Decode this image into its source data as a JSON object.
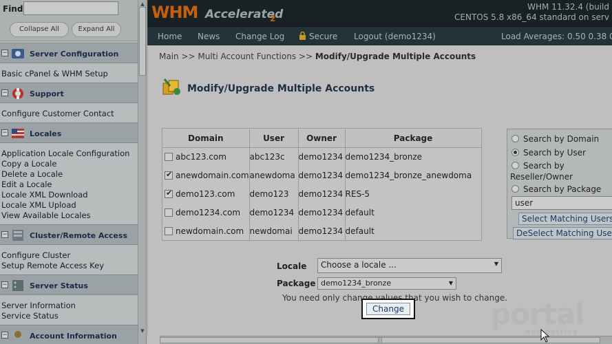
{
  "sidebar": {
    "find_label": "Find",
    "find_value": "",
    "collapse_all": "Collapse All",
    "expand_all": "Expand All",
    "sections": [
      {
        "title": "Server Configuration",
        "icon": "wrench-icon",
        "links": [
          "Basic cPanel & WHM Setup"
        ]
      },
      {
        "title": "Support",
        "icon": "lifebuoy-icon",
        "links": [
          "Configure Customer Contact"
        ]
      },
      {
        "title": "Locales",
        "icon": "flag-icon",
        "links": [
          "Application Locale Configuration",
          "Copy a Locale",
          "Delete a Locale",
          "Edit a Locale",
          "Locale XML Download",
          "Locale XML Upload",
          "View Available Locales"
        ]
      },
      {
        "title": "Cluster/Remote Access",
        "icon": "server-icon",
        "links": [
          "Configure Cluster",
          "Setup Remote Access Key"
        ]
      },
      {
        "title": "Server Status",
        "icon": "server-status-icon",
        "links": [
          "Server Information",
          "Service Status"
        ]
      },
      {
        "title": "Account Information",
        "icon": "account-icon",
        "links": []
      }
    ]
  },
  "header": {
    "logo_whm": "WHM",
    "logo_accelerated": "Accelerated",
    "logo_version": "2",
    "version_line1": "WHM 11.32.4 (build",
    "version_line2": "CENTOS 5.8 x86_64 standard on serv"
  },
  "nav": {
    "items": [
      "Home",
      "News",
      "Change Log",
      "Secure",
      "Logout (demo1234)"
    ],
    "load_averages": "Load Averages: 0.50 0.38 0"
  },
  "breadcrumb": {
    "path": "Main >> Multi Account Functions >> ",
    "current": "Modify/Upgrade Multiple Accounts"
  },
  "page_title": "Modify/Upgrade Multiple Accounts",
  "table": {
    "headers": [
      "Domain",
      "User",
      "Owner",
      "Package"
    ],
    "rows": [
      {
        "checked": false,
        "domain": "abc123.com",
        "user": "abc123c",
        "owner": "demo1234",
        "package": "demo1234_bronze"
      },
      {
        "checked": true,
        "domain": "anewdomain.com",
        "user": "anewdoma",
        "owner": "demo1234",
        "package": "demo1234_bronze_anewdoma"
      },
      {
        "checked": true,
        "domain": "demo123.com",
        "user": "demo123",
        "owner": "demo1234",
        "package": "RES-5"
      },
      {
        "checked": false,
        "domain": "demo1234.com",
        "user": "demo1234",
        "owner": "demo1234",
        "package": "default"
      },
      {
        "checked": false,
        "domain": "newdomain.com",
        "user": "newdomai",
        "owner": "demo1234",
        "package": "default"
      }
    ]
  },
  "search_panel": {
    "options": [
      "Search by Domain",
      "Search by User",
      "Search by",
      "Reseller/Owner",
      "Search by Package"
    ],
    "selected": "Search by User",
    "input_value": "user",
    "select_button": "Select Matching Users",
    "deselect_button": "DeSelect Matching User"
  },
  "form": {
    "locale_label": "Locale",
    "locale_value": "Choose a locale ...",
    "package_label": "Package",
    "package_value": "demo1234_bronze",
    "hint": "You need only change values that you wish to change.",
    "change_button": "Change"
  },
  "watermark": {
    "text": "portal",
    "sub": "web hosting"
  },
  "colors": {
    "banner": "#1a2125",
    "nav": "#24333a",
    "logo_orange": "#c2610c",
    "sidebar_header": "#9aa2a5"
  }
}
